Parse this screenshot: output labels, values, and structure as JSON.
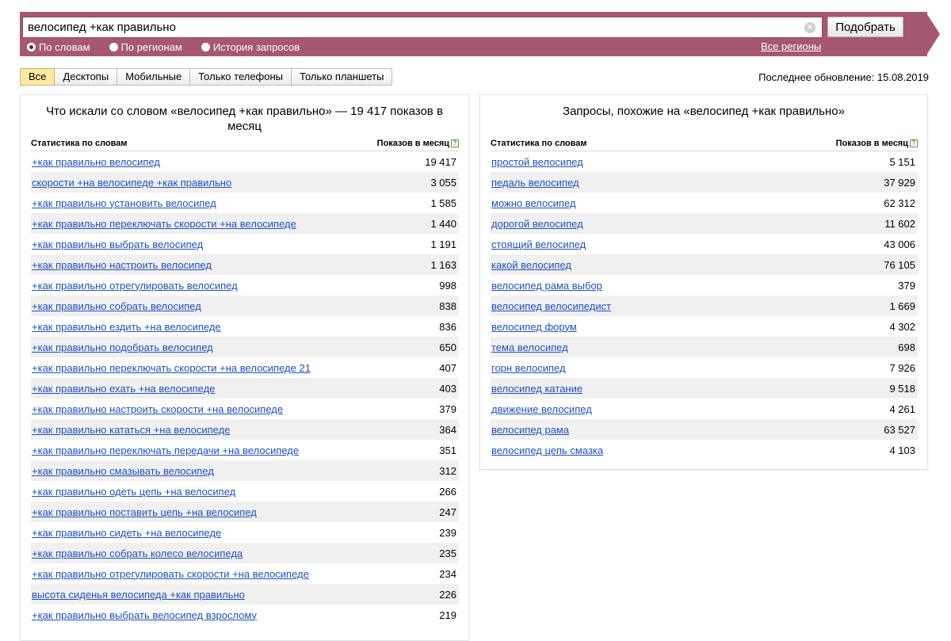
{
  "search": {
    "query": "велосипед +как правильно",
    "button_label": "Подобрать",
    "modes": [
      {
        "label": "По словам",
        "checked": true
      },
      {
        "label": "По регионам",
        "checked": false
      },
      {
        "label": "История запросов",
        "checked": false
      }
    ],
    "regions_link": "Все регионы"
  },
  "tabs": [
    {
      "label": "Все",
      "active": true
    },
    {
      "label": "Десктопы",
      "active": false
    },
    {
      "label": "Мобильные",
      "active": false
    },
    {
      "label": "Только телефоны",
      "active": false
    },
    {
      "label": "Только планшеты",
      "active": false
    }
  ],
  "updated_text": "Последнее обновление: 15.08.2019",
  "left_panel": {
    "title": "Что искали со словом «велосипед +как правильно» — 19 417 показов в месяц",
    "col_phrase": "Статистика по словам",
    "col_count": "Показов в месяц",
    "rows": [
      {
        "phrase": "+как правильно велосипед",
        "count": "19 417"
      },
      {
        "phrase": "скорости +на велосипеде +как правильно",
        "count": "3 055"
      },
      {
        "phrase": "+как правильно установить велосипед",
        "count": "1 585"
      },
      {
        "phrase": "+как правильно переключать скорости +на велосипеде",
        "count": "1 440"
      },
      {
        "phrase": "+как правильно выбрать велосипед",
        "count": "1 191"
      },
      {
        "phrase": "+как правильно настроить велосипед",
        "count": "1 163"
      },
      {
        "phrase": "+как правильно отрегулировать велосипед",
        "count": "998"
      },
      {
        "phrase": "+как правильно собрать велосипед",
        "count": "838"
      },
      {
        "phrase": "+как правильно ездить +на велосипеде",
        "count": "836"
      },
      {
        "phrase": "+как правильно подобрать велосипед",
        "count": "650"
      },
      {
        "phrase": "+как правильно переключать скорости +на велосипеде 21",
        "count": "407"
      },
      {
        "phrase": "+как правильно ехать +на велосипеде",
        "count": "403"
      },
      {
        "phrase": "+как правильно настроить скорости +на велосипеде",
        "count": "379"
      },
      {
        "phrase": "+как правильно кататься +на велосипеде",
        "count": "364"
      },
      {
        "phrase": "+как правильно переключать передачи +на велосипеде",
        "count": "351"
      },
      {
        "phrase": "+как правильно смазывать велосипед",
        "count": "312"
      },
      {
        "phrase": "+как правильно одеть цепь +на велосипед",
        "count": "266"
      },
      {
        "phrase": "+как правильно поставить цепь +на велосипед",
        "count": "247"
      },
      {
        "phrase": "+как правильно сидеть +на велосипеде",
        "count": "239"
      },
      {
        "phrase": "+как правильно собрать колесо велосипеда",
        "count": "235"
      },
      {
        "phrase": "+как правильно отрегулировать скорости +на велосипеде",
        "count": "234"
      },
      {
        "phrase": "высота сиденья велосипеда +как правильно",
        "count": "226"
      },
      {
        "phrase": "+как правильно выбрать велосипед взрослому",
        "count": "219"
      }
    ]
  },
  "right_panel": {
    "title": "Запросы, похожие на «велосипед +как правильно»",
    "col_phrase": "Статистика по словам",
    "col_count": "Показов в месяц",
    "rows": [
      {
        "phrase": "простой велосипед",
        "count": "5 151"
      },
      {
        "phrase": "педаль велосипед",
        "count": "37 929"
      },
      {
        "phrase": "можно велосипед",
        "count": "62 312"
      },
      {
        "phrase": "дорогой велосипед",
        "count": "11 602"
      },
      {
        "phrase": "стоящий велосипед",
        "count": "43 006"
      },
      {
        "phrase": "какой велосипед",
        "count": "76 105"
      },
      {
        "phrase": "велосипед рама выбор",
        "count": "379"
      },
      {
        "phrase": "велосипед велосипедист",
        "count": "1 669"
      },
      {
        "phrase": "велосипед форум",
        "count": "4 302"
      },
      {
        "phrase": "тема велосипед",
        "count": "698"
      },
      {
        "phrase": "горн велосипед",
        "count": "7 926"
      },
      {
        "phrase": "велосипед катание",
        "count": "9 518"
      },
      {
        "phrase": "движение велосипед",
        "count": "4 261"
      },
      {
        "phrase": "велосипед рама",
        "count": "63 527"
      },
      {
        "phrase": "велосипед цепь смазка",
        "count": "4 103"
      }
    ]
  },
  "colors": {
    "banner": "#a5586f",
    "link": "#1f4fbf",
    "active_tab": "#fde9a3",
    "row_alt": "#f0f0f0"
  },
  "icons": {
    "clear": "clear-icon",
    "help": "help-icon"
  }
}
